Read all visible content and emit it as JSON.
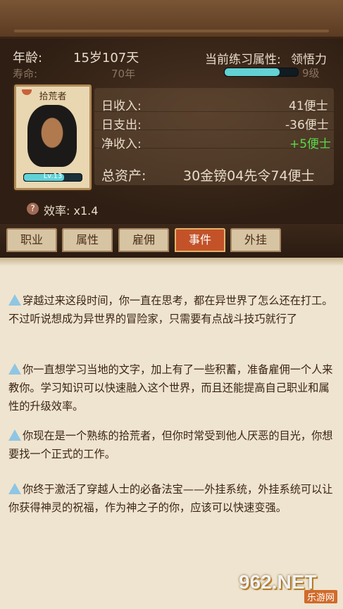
{
  "header": {
    "age_label": "年龄:",
    "age_value": "15岁107天",
    "lifespan_label": "寿命:",
    "lifespan_value": "70年",
    "practice_label": "当前练习属性:",
    "practice_value": "领悟力",
    "practice_level": "9级",
    "practice_progress": 0.75
  },
  "character": {
    "title": "拾荒者",
    "level": "Lv.13",
    "level_progress": 0.7
  },
  "stats": {
    "daily_income_label": "日收入:",
    "daily_income_value": "41便士",
    "daily_expense_label": "日支出:",
    "daily_expense_value": "-36便士",
    "net_income_label": "净收入:",
    "net_income_value": "+5便士",
    "total_assets_label": "总资产:",
    "total_assets_value": "30金镑04先令74便士",
    "efficiency_label": "效率: x1.4",
    "help_glyph": "?"
  },
  "tabs": [
    {
      "label": "职业"
    },
    {
      "label": "属性"
    },
    {
      "label": "雇佣"
    },
    {
      "label": "事件"
    },
    {
      "label": "外挂"
    }
  ],
  "active_tab": "事件",
  "events": [
    "穿越过来这段时间，你一直在思考，都在异世界了怎么还在打工。不过听说想成为异世界的冒险家，只需要有点战斗技巧就行了",
    "你一直想学习当地的文字，加上有了一些积蓄，准备雇佣一个人来教你。学习知识可以快速融入这个世界，而且还能提高自己职业和属性的升级效率。",
    "你现在是一个熟练的拾荒者，但你时常受到他人厌恶的目光，你想要找一个正式的工作。",
    "你终于激活了穿越人士的必备法宝——外挂系统，外挂系统可以让你获得神灵的祝福，作为神之子的你，应该可以快速变强。"
  ],
  "watermark": {
    "main": "962.NET",
    "sub": "乐游网"
  },
  "colors": {
    "active_tab": "#c35228",
    "progress": "#62d2d4",
    "positive": "#59d94a"
  }
}
